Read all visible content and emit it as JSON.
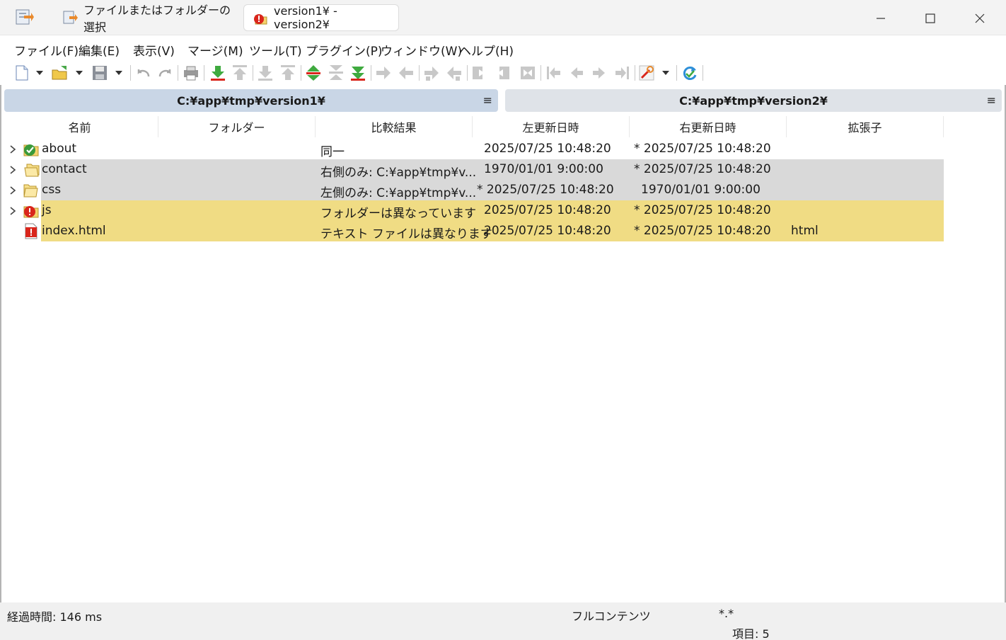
{
  "titlebar": {
    "tabs": [
      {
        "label": "ファイルまたはフォルダーの選択",
        "active": false
      },
      {
        "label": "version1¥ - version2¥",
        "active": true
      }
    ]
  },
  "menu": [
    "ファイル(F)",
    "編集(E)",
    "表示(V)",
    "マージ(M)",
    "ツール(T)",
    "プラグイン(P)",
    "ウィンドウ(W)",
    "ヘルプ(H)"
  ],
  "paths": {
    "left": "C:¥app¥tmp¥version1¥",
    "right": "C:¥app¥tmp¥version2¥",
    "menu_glyph": "≡"
  },
  "columns": [
    "名前",
    "フォルダー",
    "比較結果",
    "左更新日時",
    "右更新日時",
    "拡張子"
  ],
  "rows": [
    {
      "name": "about",
      "folder": "",
      "result": "同一",
      "left_date": "2025/07/25 10:48:20",
      "right_date": "* 2025/07/25 10:48:20",
      "ext": "",
      "icon": "folder-identical-icon",
      "status": "identical",
      "expandable": true
    },
    {
      "name": "contact",
      "folder": "",
      "result": "右側のみ: C:¥app¥tmp¥v...",
      "left_date": "1970/01/01 9:00:00",
      "right_date": "* 2025/07/25 10:48:20",
      "ext": "",
      "icon": "folder-right-only-icon",
      "status": "unique",
      "expandable": true
    },
    {
      "name": "css",
      "folder": "",
      "result": "左側のみ: C:¥app¥tmp¥v...",
      "left_date": "* 2025/07/25 10:48:20",
      "right_date": "1970/01/01 9:00:00",
      "ext": "",
      "icon": "folder-left-only-icon",
      "status": "unique",
      "expandable": true
    },
    {
      "name": "js",
      "folder": "",
      "result": "フォルダーは異なっています",
      "left_date": "2025/07/25 10:48:20",
      "right_date": "* 2025/07/25 10:48:20",
      "ext": "",
      "icon": "folder-different-icon",
      "status": "different",
      "expandable": true
    },
    {
      "name": "index.html",
      "folder": "",
      "result": "テキスト ファイルは異なります",
      "left_date": "2025/07/25 10:48:20",
      "right_date": "* 2025/07/25 10:48:20",
      "ext": "html",
      "icon": "file-different-icon",
      "status": "different",
      "expandable": false
    }
  ],
  "status": {
    "elapsed": "経過時間: 146 ms",
    "compare_method": "フルコンテンツ",
    "filter": "*.*",
    "items": "項目: 5"
  },
  "colors": {
    "unique_row": "#d9d9d9",
    "different_row": "#f0dc84",
    "left_path_bg": "#c9d6e6",
    "right_path_bg": "#dfe3e8"
  }
}
